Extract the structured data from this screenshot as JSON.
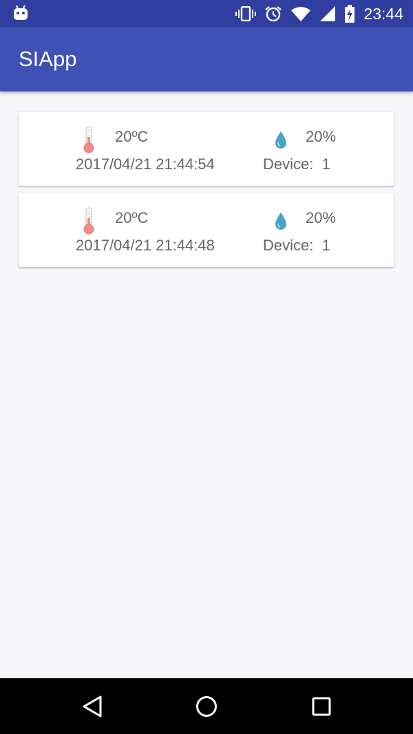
{
  "status_bar": {
    "time": "23:44",
    "icons": [
      "android-robot-icon",
      "vibrate-icon",
      "alarm-icon",
      "wifi-icon",
      "cell-signal-icon",
      "battery-charging-icon"
    ]
  },
  "app_bar": {
    "title": "SIApp"
  },
  "readings": [
    {
      "temperature": "20ºC",
      "humidity": "20%",
      "timestamp": "2017/04/21 21:44:54",
      "device": "Device:  1"
    },
    {
      "temperature": "20ºC",
      "humidity": "20%",
      "timestamp": "2017/04/21 21:44:48",
      "device": "Device:  1"
    }
  ],
  "nav_bar": {
    "icons": [
      "back-icon",
      "home-icon",
      "recents-icon"
    ]
  },
  "colors": {
    "primary": "#3f51b5",
    "primary_dark": "#303f9f",
    "thermometer": "#f28b8b",
    "drop": "#4aa3c7",
    "background": "#f7f6fa"
  }
}
